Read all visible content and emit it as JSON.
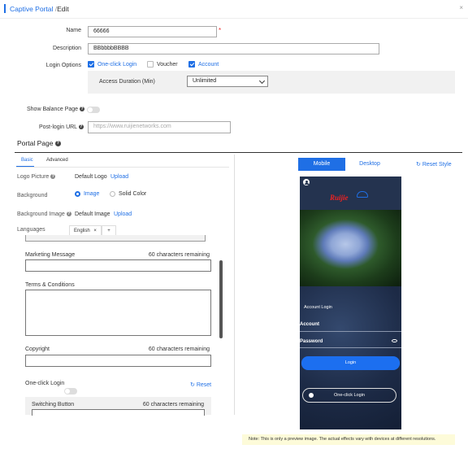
{
  "header": {
    "breadcrumb_link": "Captive Portal",
    "breadcrumb_sep": "/",
    "breadcrumb_current": "Edit",
    "close_label": "×"
  },
  "form": {
    "name_label": "Name",
    "name_value": "66666",
    "description_label": "Description",
    "description_value": "BBbbbbBBBB",
    "login_options_label": "Login Options",
    "login_options": [
      {
        "label": "One-click Login",
        "checked": true
      },
      {
        "label": "Voucher",
        "checked": false
      },
      {
        "label": "Account",
        "checked": true
      }
    ],
    "access_duration_label": "Access Duration (Min)",
    "access_duration_value": "Unlimited",
    "show_balance_label": "Show Balance Page",
    "post_login_label": "Post-login URL",
    "post_login_placeholder": "https://www.ruijienetworks.com"
  },
  "portal": {
    "section_title": "Portal Page",
    "tabs": [
      "Basic",
      "Advanced"
    ],
    "logo_label": "Logo Picture",
    "logo_value": "Default Logo",
    "logo_upload": "Upload",
    "background_label": "Background",
    "bg_option_image": "Image",
    "bg_option_solid": "Solid Color",
    "bg_image_label": "Background Image",
    "bg_image_value": "Default Image",
    "bg_image_upload": "Upload",
    "languages_label": "Languages",
    "lang_tab": "English",
    "lang_tab_close": "×",
    "lang_add": "+",
    "marketing_label": "Marketing Message",
    "marketing_remaining": "60  characters remaining",
    "terms_label": "Terms & Conditions",
    "copyright_label": "Copyright",
    "copyright_remaining": "60  characters remaining",
    "one_click_label": "One-click Login",
    "reset_label": "Reset",
    "switching_label": "Switching Button",
    "switching_remaining": "60  characters remaining"
  },
  "preview": {
    "mobile_label": "Mobile",
    "desktop_label": "Desktop",
    "reset_style_label": "Reset Style",
    "brand_text": "Ruijie",
    "account_login": "Account Login",
    "account": "Account",
    "password": "Password",
    "login_button": "Login",
    "one_click_button": "One-click Login",
    "note": "Note: This is only a preview image. The actual effects vary with devices at different resolutions."
  },
  "colors": {
    "accent": "#1f6fe5",
    "required": "#ee3333",
    "note_bg": "#fdfbd9"
  }
}
